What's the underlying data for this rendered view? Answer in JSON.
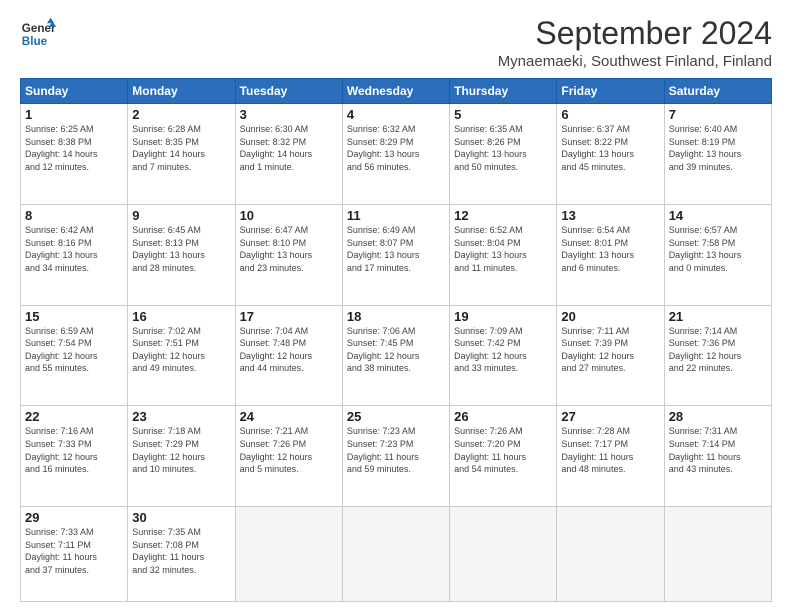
{
  "header": {
    "logo_line1": "General",
    "logo_line2": "Blue",
    "title": "September 2024",
    "subtitle": "Mynaemaeki, Southwest Finland, Finland"
  },
  "columns": [
    "Sunday",
    "Monday",
    "Tuesday",
    "Wednesday",
    "Thursday",
    "Friday",
    "Saturday"
  ],
  "weeks": [
    [
      {
        "day": "1",
        "info": "Sunrise: 6:25 AM\nSunset: 8:38 PM\nDaylight: 14 hours\nand 12 minutes."
      },
      {
        "day": "2",
        "info": "Sunrise: 6:28 AM\nSunset: 8:35 PM\nDaylight: 14 hours\nand 7 minutes."
      },
      {
        "day": "3",
        "info": "Sunrise: 6:30 AM\nSunset: 8:32 PM\nDaylight: 14 hours\nand 1 minute."
      },
      {
        "day": "4",
        "info": "Sunrise: 6:32 AM\nSunset: 8:29 PM\nDaylight: 13 hours\nand 56 minutes."
      },
      {
        "day": "5",
        "info": "Sunrise: 6:35 AM\nSunset: 8:26 PM\nDaylight: 13 hours\nand 50 minutes."
      },
      {
        "day": "6",
        "info": "Sunrise: 6:37 AM\nSunset: 8:22 PM\nDaylight: 13 hours\nand 45 minutes."
      },
      {
        "day": "7",
        "info": "Sunrise: 6:40 AM\nSunset: 8:19 PM\nDaylight: 13 hours\nand 39 minutes."
      }
    ],
    [
      {
        "day": "8",
        "info": "Sunrise: 6:42 AM\nSunset: 8:16 PM\nDaylight: 13 hours\nand 34 minutes."
      },
      {
        "day": "9",
        "info": "Sunrise: 6:45 AM\nSunset: 8:13 PM\nDaylight: 13 hours\nand 28 minutes."
      },
      {
        "day": "10",
        "info": "Sunrise: 6:47 AM\nSunset: 8:10 PM\nDaylight: 13 hours\nand 23 minutes."
      },
      {
        "day": "11",
        "info": "Sunrise: 6:49 AM\nSunset: 8:07 PM\nDaylight: 13 hours\nand 17 minutes."
      },
      {
        "day": "12",
        "info": "Sunrise: 6:52 AM\nSunset: 8:04 PM\nDaylight: 13 hours\nand 11 minutes."
      },
      {
        "day": "13",
        "info": "Sunrise: 6:54 AM\nSunset: 8:01 PM\nDaylight: 13 hours\nand 6 minutes."
      },
      {
        "day": "14",
        "info": "Sunrise: 6:57 AM\nSunset: 7:58 PM\nDaylight: 13 hours\nand 0 minutes."
      }
    ],
    [
      {
        "day": "15",
        "info": "Sunrise: 6:59 AM\nSunset: 7:54 PM\nDaylight: 12 hours\nand 55 minutes."
      },
      {
        "day": "16",
        "info": "Sunrise: 7:02 AM\nSunset: 7:51 PM\nDaylight: 12 hours\nand 49 minutes."
      },
      {
        "day": "17",
        "info": "Sunrise: 7:04 AM\nSunset: 7:48 PM\nDaylight: 12 hours\nand 44 minutes."
      },
      {
        "day": "18",
        "info": "Sunrise: 7:06 AM\nSunset: 7:45 PM\nDaylight: 12 hours\nand 38 minutes."
      },
      {
        "day": "19",
        "info": "Sunrise: 7:09 AM\nSunset: 7:42 PM\nDaylight: 12 hours\nand 33 minutes."
      },
      {
        "day": "20",
        "info": "Sunrise: 7:11 AM\nSunset: 7:39 PM\nDaylight: 12 hours\nand 27 minutes."
      },
      {
        "day": "21",
        "info": "Sunrise: 7:14 AM\nSunset: 7:36 PM\nDaylight: 12 hours\nand 22 minutes."
      }
    ],
    [
      {
        "day": "22",
        "info": "Sunrise: 7:16 AM\nSunset: 7:33 PM\nDaylight: 12 hours\nand 16 minutes."
      },
      {
        "day": "23",
        "info": "Sunrise: 7:18 AM\nSunset: 7:29 PM\nDaylight: 12 hours\nand 10 minutes."
      },
      {
        "day": "24",
        "info": "Sunrise: 7:21 AM\nSunset: 7:26 PM\nDaylight: 12 hours\nand 5 minutes."
      },
      {
        "day": "25",
        "info": "Sunrise: 7:23 AM\nSunset: 7:23 PM\nDaylight: 11 hours\nand 59 minutes."
      },
      {
        "day": "26",
        "info": "Sunrise: 7:26 AM\nSunset: 7:20 PM\nDaylight: 11 hours\nand 54 minutes."
      },
      {
        "day": "27",
        "info": "Sunrise: 7:28 AM\nSunset: 7:17 PM\nDaylight: 11 hours\nand 48 minutes."
      },
      {
        "day": "28",
        "info": "Sunrise: 7:31 AM\nSunset: 7:14 PM\nDaylight: 11 hours\nand 43 minutes."
      }
    ],
    [
      {
        "day": "29",
        "info": "Sunrise: 7:33 AM\nSunset: 7:11 PM\nDaylight: 11 hours\nand 37 minutes."
      },
      {
        "day": "30",
        "info": "Sunrise: 7:35 AM\nSunset: 7:08 PM\nDaylight: 11 hours\nand 32 minutes."
      },
      {
        "day": "",
        "info": ""
      },
      {
        "day": "",
        "info": ""
      },
      {
        "day": "",
        "info": ""
      },
      {
        "day": "",
        "info": ""
      },
      {
        "day": "",
        "info": ""
      }
    ]
  ]
}
